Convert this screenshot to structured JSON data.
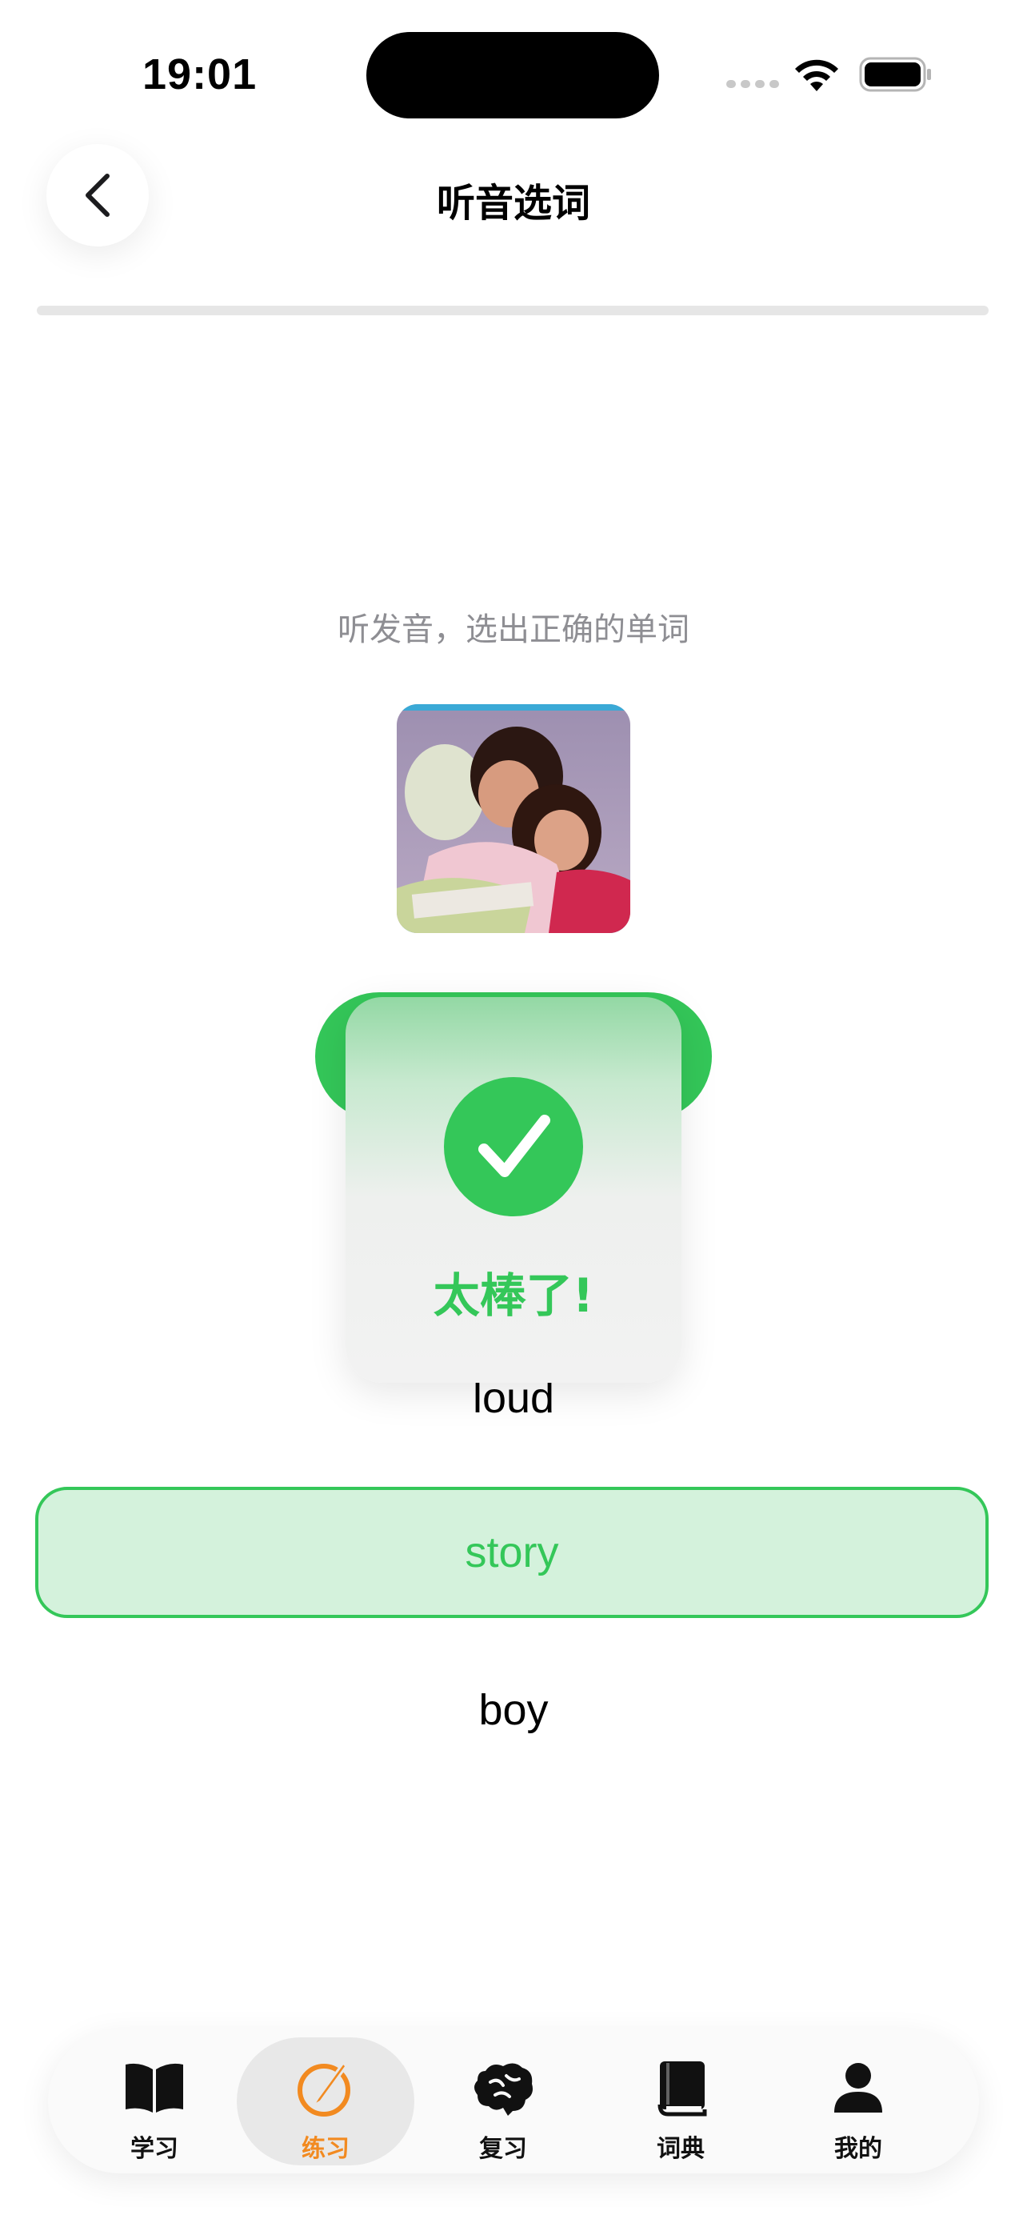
{
  "status_bar": {
    "time": "19:01"
  },
  "header": {
    "title": "听音选词"
  },
  "progress": {
    "fraction": 0
  },
  "prompt": {
    "instruction": "听发音，选出正确的单词"
  },
  "options": [
    {
      "label": "",
      "state": "correct-highlight"
    },
    {
      "label": "loud",
      "state": "normal"
    },
    {
      "label": "story",
      "state": "selected-correct"
    },
    {
      "label": "boy",
      "state": "normal"
    }
  ],
  "feedback": {
    "message": "太棒了!",
    "icon": "checkmark-icon"
  },
  "tab_bar": {
    "items": [
      {
        "label": "学习",
        "icon": "book-icon"
      },
      {
        "label": "练习",
        "icon": "pencil-circle-icon",
        "active": true
      },
      {
        "label": "复习",
        "icon": "brain-icon"
      },
      {
        "label": "词典",
        "icon": "dictionary-icon"
      },
      {
        "label": "我的",
        "icon": "person-icon"
      }
    ]
  },
  "colors": {
    "accent_green": "#34c759",
    "active_tab": "#f28a20",
    "muted_text": "#8e8e93"
  }
}
